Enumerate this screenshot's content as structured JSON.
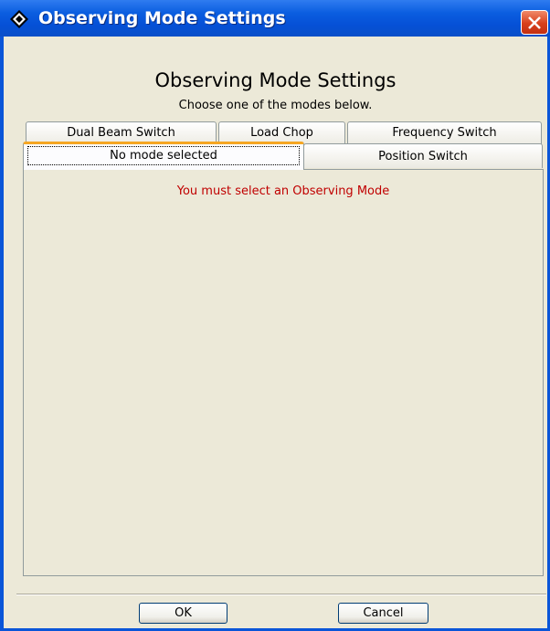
{
  "window": {
    "title": "Observing Mode Settings",
    "close_icon": "close-icon"
  },
  "header": {
    "title": "Observing Mode Settings",
    "subtitle": "Choose one of the modes below."
  },
  "tabs": {
    "row_back": [
      {
        "label": "Dual Beam Switch"
      },
      {
        "label": "Load Chop"
      },
      {
        "label": "Frequency Switch"
      }
    ],
    "row_front": [
      {
        "label": "No mode selected",
        "selected": true
      },
      {
        "label": "Position Switch",
        "selected": false
      }
    ]
  },
  "panel": {
    "message": "You must select an Observing Mode",
    "message_color": "#c00000"
  },
  "buttons": {
    "ok_label": "OK",
    "cancel_label": "Cancel"
  },
  "colors": {
    "titlebar": "#0550d6",
    "client_bg": "#ece9d8",
    "active_tab_accent": "#f5a623",
    "close_button": "#d8401c"
  }
}
